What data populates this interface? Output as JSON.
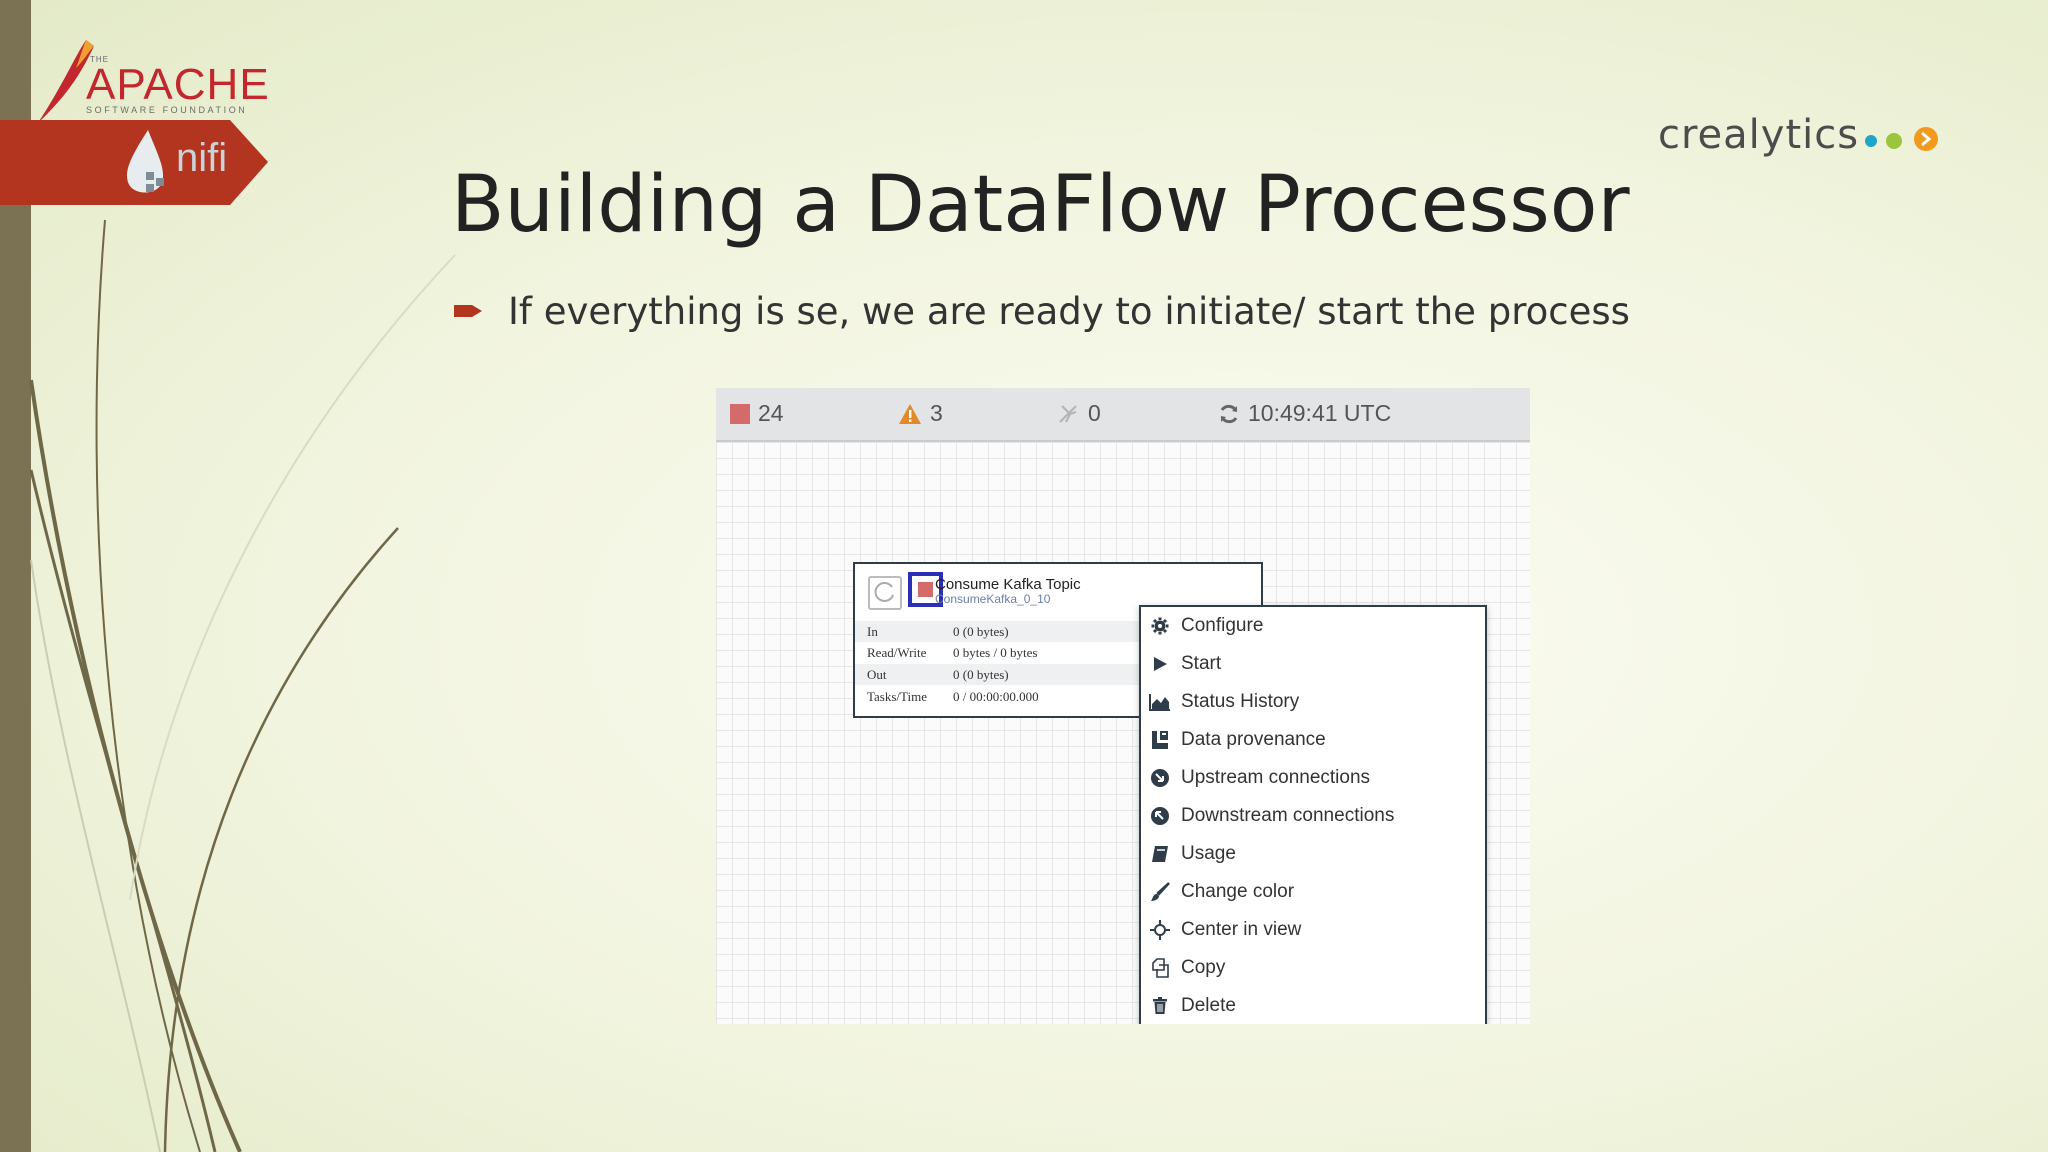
{
  "branding": {
    "apache_the": "THE",
    "apache_word": "APACHE",
    "apache_sub": "SOFTWARE FOUNDATION",
    "nifi_word": "nifi",
    "crealytics": "crealytics"
  },
  "slide": {
    "title": "Building a DataFlow Processor",
    "bullet": "If everything is se, we are ready to initiate/ start the process"
  },
  "statusbar": {
    "stopped_count": "24",
    "warning_count": "3",
    "disabled_count": "0",
    "time": "10:49:41 UTC"
  },
  "processor": {
    "name": "Consume Kafka Topic",
    "type": "ConsumeKafka_0_10",
    "stats": [
      {
        "label": "In",
        "value": "0 (0 bytes)"
      },
      {
        "label": "Read/Write",
        "value": "0 bytes / 0 bytes"
      },
      {
        "label": "Out",
        "value": "0 (0 bytes)"
      },
      {
        "label": "Tasks/Time",
        "value": "0 / 00:00:00.000"
      }
    ]
  },
  "context_menu": {
    "items": [
      {
        "label": "Configure",
        "icon": "gear-icon"
      },
      {
        "label": "Start",
        "icon": "play-icon"
      },
      {
        "label": "Status History",
        "icon": "area-chart-icon"
      },
      {
        "label": "Data provenance",
        "icon": "provenance-icon"
      },
      {
        "label": "Upstream connections",
        "icon": "upstream-icon"
      },
      {
        "label": "Downstream connections",
        "icon": "downstream-icon"
      },
      {
        "label": "Usage",
        "icon": "book-icon"
      },
      {
        "label": "Change color",
        "icon": "brush-icon"
      },
      {
        "label": "Center in view",
        "icon": "crosshair-icon"
      },
      {
        "label": "Copy",
        "icon": "copy-icon"
      },
      {
        "label": "Delete",
        "icon": "trash-icon"
      }
    ]
  },
  "colors": {
    "accent_red": "#c1272d",
    "stop_red": "#d46a6a",
    "warning_orange": "#e08a2c",
    "dot_blue": "#1ea6c8",
    "dot_green": "#9bc53d",
    "dot_orange": "#f29a1e"
  }
}
